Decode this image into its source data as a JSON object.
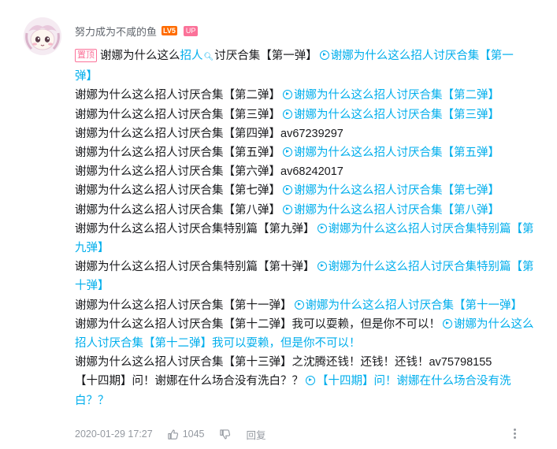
{
  "comment": {
    "username": "努力成为不咸的鱼",
    "level_badge": "LV5",
    "up_badge": "UP",
    "pinned_label": "置顶",
    "search_keyword": "招人",
    "lines": [
      {
        "plain": "谢娜为什么这么",
        "keyword_prefix": true,
        "after": "讨厌合集【第一弹】",
        "link": "谢娜为什么这么招人讨厌合集【第一弹】"
      },
      {
        "plain": "谢娜为什么这么招人讨厌合集【第二弹】",
        "link": "谢娜为什么这么招人讨厌合集【第二弹】"
      },
      {
        "plain": "谢娜为什么这么招人讨厌合集【第三弹】",
        "link": "谢娜为什么这么招人讨厌合集【第三弹】"
      },
      {
        "plain": "谢娜为什么这么招人讨厌合集【第四弹】av67239297"
      },
      {
        "plain": "谢娜为什么这么招人讨厌合集【第五弹】",
        "link": "谢娜为什么这么招人讨厌合集【第五弹】"
      },
      {
        "plain": "谢娜为什么这么招人讨厌合集【第六弹】av68242017"
      },
      {
        "plain": "谢娜为什么这么招人讨厌合集【第七弹】",
        "link": "谢娜为什么这么招人讨厌合集【第七弹】"
      },
      {
        "plain": "谢娜为什么这么招人讨厌合集【第八弹】",
        "link": "谢娜为什么这么招人讨厌合集【第八弹】"
      },
      {
        "plain": "谢娜为什么这么招人讨厌合集特别篇【第九弹】",
        "link": "谢娜为什么这么招人讨厌合集特别篇【第九弹】"
      },
      {
        "plain": "谢娜为什么这么招人讨厌合集特别篇【第十弹】",
        "link": "谢娜为什么这么招人讨厌合集特别篇【第十弹】"
      },
      {
        "plain": "谢娜为什么这么招人讨厌合集【第十一弹】",
        "link": "谢娜为什么这么招人讨厌合集【第十一弹】"
      },
      {
        "plain": "谢娜为什么这么招人讨厌合集【第十二弹】我可以耍赖，但是你不可以！",
        "link": "谢娜为什么这么招人讨厌合集【第十二弹】我可以耍赖，但是你不可以！"
      },
      {
        "plain": "谢娜为什么这么招人讨厌合集【第十三弹】之沈腾还钱！还钱！还钱！av75798155"
      },
      {
        "plain": "【十四期】问！谢娜在什么场合没有洗白？？",
        "link": "【十四期】问！谢娜在什么场合没有洗白？？"
      }
    ],
    "timestamp": "2020-01-29 17:27",
    "like_count": "1045",
    "reply_label": "回复"
  },
  "colors": {
    "link": "#00aeec",
    "text": "#18191c",
    "muted": "#9499a0",
    "pin": "#fb7299",
    "level": "#ff6c00"
  },
  "icons": [
    "search-icon",
    "video-link-icon",
    "thumbs-up-icon",
    "thumbs-down-icon",
    "more-icon"
  ]
}
